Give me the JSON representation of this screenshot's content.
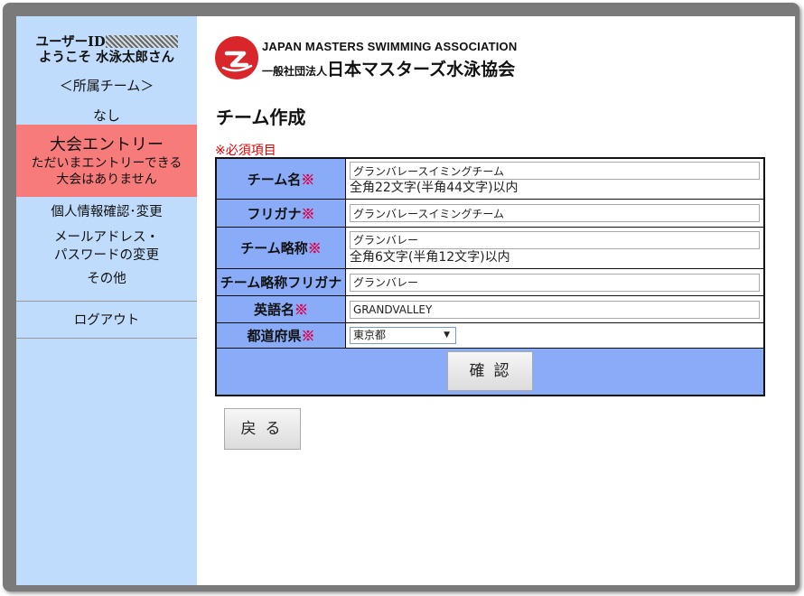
{
  "sidebar": {
    "user_id_label": "ユーザーID",
    "welcome": "ようこそ 水泳太郎さん",
    "team_heading": "＜所属チーム＞",
    "team_value": "なし",
    "entry": {
      "title": "大会エントリー",
      "line1": "ただいまエントリーできる",
      "line2": "大会はありません"
    },
    "links": {
      "profile": "個人情報確認･変更",
      "email_pw_1": "メールアドレス・",
      "email_pw_2": "パスワードの変更",
      "other": "その他",
      "logout": "ログアウト"
    }
  },
  "header": {
    "org_en": "JAPAN MASTERS SWIMMING ASSOCIATION",
    "org_prefix": "一般社団法人",
    "org_jp": "日本マスターズ水泳協会"
  },
  "page": {
    "title": "チーム作成",
    "required_note": "※必須項目",
    "required_mark": "※"
  },
  "form": {
    "team_name": {
      "label": "チーム名",
      "value": "グランバレースイミングチーム",
      "hint": "全角22文字(半角44文字)以内"
    },
    "furigana": {
      "label": "フリガナ",
      "value": "グランバレースイミングチーム"
    },
    "short_name": {
      "label": "チーム略称",
      "value": "グランバレー",
      "hint": "全角6文字(半角12文字)以内"
    },
    "short_furigana": {
      "label": "チーム略称フリガナ",
      "value": "グランバレー"
    },
    "english_name": {
      "label": "英語名",
      "value": "GRANDVALLEY"
    },
    "prefecture": {
      "label": "都道府県",
      "value": "東京都"
    }
  },
  "buttons": {
    "confirm": "確認",
    "back": "戻る"
  },
  "colors": {
    "sidebar_bg": "#bfdcfc",
    "entry_bg": "#f77b7b",
    "label_bg": "#8aacf8",
    "required": "#e0004a",
    "logo_red": "#d9262b"
  }
}
